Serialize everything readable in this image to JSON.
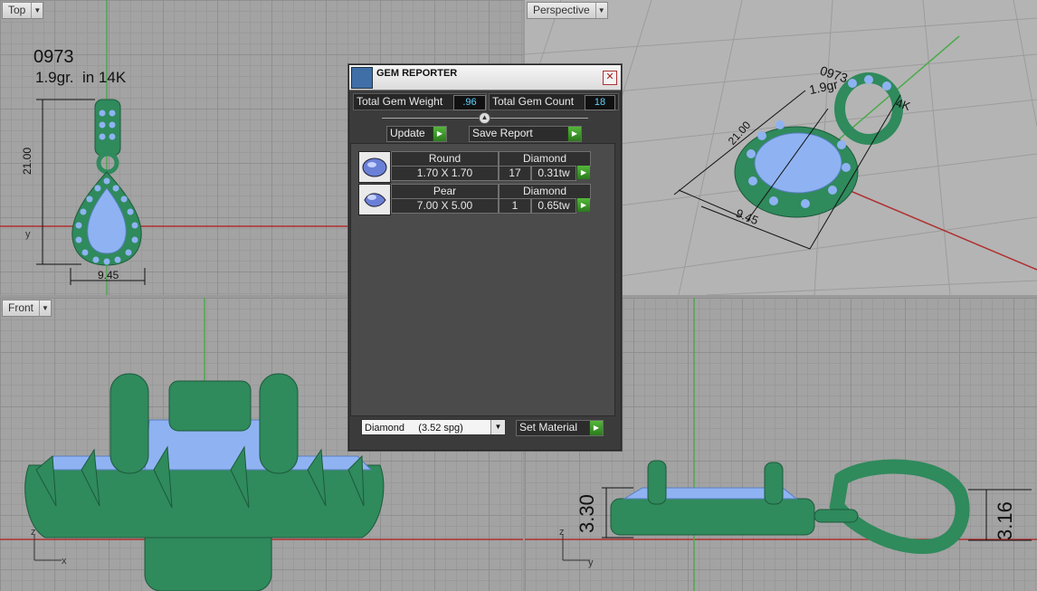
{
  "viewports": {
    "top": {
      "label": "Top"
    },
    "perspective": {
      "label": "Perspective"
    },
    "front": {
      "label": "Front"
    },
    "right": {
      "label": ""
    }
  },
  "annotations": {
    "model_id": "0973",
    "weight_line": "1.9gr.  in 14K",
    "dim_height": "21.00",
    "dim_width": "9.45",
    "persp_model_id": "0973",
    "persp_weight": "1.9gr",
    "persp_alloy": "4K",
    "persp_height": "21.00",
    "persp_width": "9.45",
    "right_dim_left": "3.30",
    "right_dim_right": "3.16",
    "axis_x": "x",
    "axis_y": "y",
    "axis_z": "z"
  },
  "gem_reporter": {
    "title": "GEM REPORTER",
    "close_glyph": "✕",
    "total_weight_label": "Total Gem Weight",
    "total_weight_value": ".96",
    "total_count_label": "Total Gem Count",
    "total_count_value": "18",
    "update_label": "Update",
    "save_label": "Save Report",
    "gems": [
      {
        "shape": "Round",
        "material": "Diamond",
        "size": "1.70 X 1.70",
        "count": "17",
        "weight": "0.31tw"
      },
      {
        "shape": "Pear",
        "material": "Diamond",
        "size": "7.00 X 5.00",
        "count": "1",
        "weight": "0.65tw"
      }
    ],
    "material_selected": "Diamond     (3.52 spg)",
    "set_material_label": "Set Material"
  },
  "colors": {
    "metal": "#2f8a5c",
    "gem": "#8fb3f2",
    "axis_red": "#b03030",
    "axis_green": "#4caa4c"
  },
  "icons": {
    "dropdown": "chevron-down-icon",
    "go": "play-arrow-icon",
    "close": "close-icon"
  }
}
